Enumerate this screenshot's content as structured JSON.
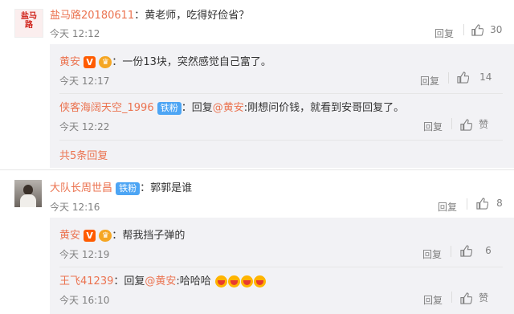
{
  "comments": [
    {
      "user": "盐马路20180611",
      "sep": "：",
      "text": "黄老师，吃得好俭省？",
      "time": "今天 12:12",
      "reply_label": "回复",
      "likes": "30",
      "avatar_text": "盐马路",
      "replies": [
        {
          "user": "黄安",
          "sep": "：",
          "text": "一份13块，突然感觉自己富了。",
          "time": "今天 12:17",
          "reply_label": "回复",
          "likes": "14"
        },
        {
          "user": "侠客海阔天空_1996",
          "badge": "铁粉",
          "sep": "：",
          "reply_prefix": "回复",
          "mention": "@黄安",
          "text": ":刚想问价钱，就看到安哥回复了。",
          "time": "今天 12:22",
          "reply_label": "回复",
          "likes": "赞"
        }
      ],
      "more_replies": "共5条回复"
    },
    {
      "user": "大队长周世昌",
      "badge": "铁粉",
      "sep": "：",
      "text": "郭郭是谁",
      "time": "今天 12:16",
      "reply_label": "回复",
      "likes": "8",
      "replies": [
        {
          "user": "黄安",
          "sep": "：",
          "text": "帮我挡子弹的",
          "time": "今天 12:19",
          "reply_label": "回复",
          "likes": "6"
        },
        {
          "user": "王飞41239",
          "sep": "：",
          "reply_prefix": "回复",
          "mention": "@黄安",
          "text": ":哈哈哈",
          "time": "今天 16:10",
          "reply_label": "回复",
          "likes": "赞"
        }
      ]
    }
  ],
  "badges": {
    "vip": "V",
    "crown": "♛"
  },
  "icons": {
    "like": "thumbs-up-icon",
    "emoji": "laughing-emoji-icon"
  },
  "colors": {
    "username": "#eb7350",
    "reply_bg": "#f2f2f5",
    "fan_badge": "#4da5f4",
    "meta": "#808080"
  }
}
